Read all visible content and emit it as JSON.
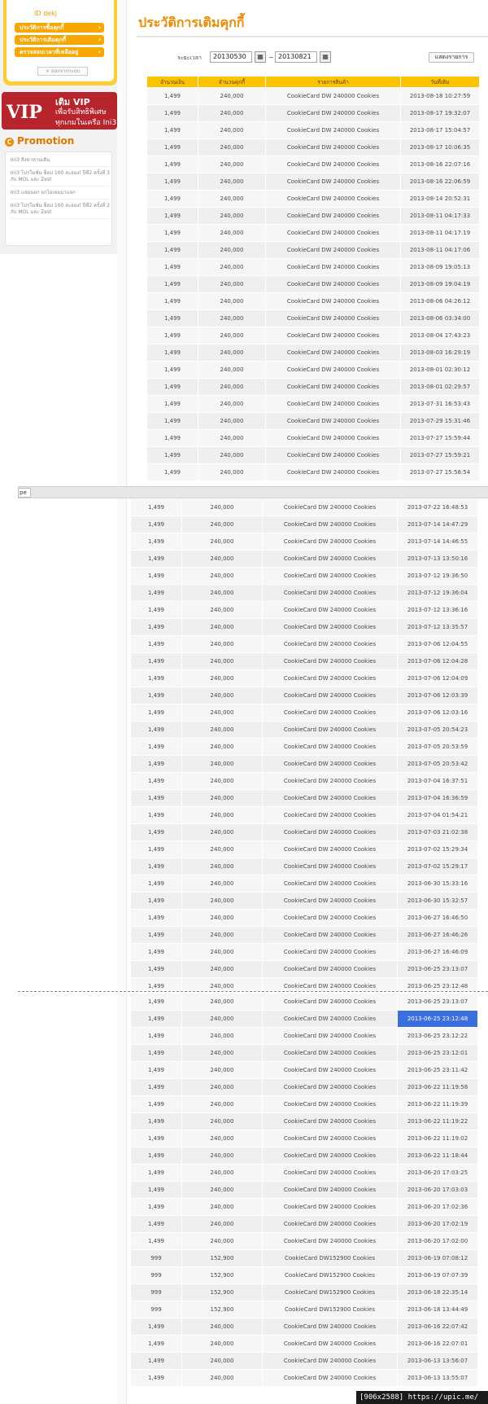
{
  "sidebar": {
    "id_label": "ID dekj",
    "menu": [
      "ประวัติการซื้อคุกกี้",
      "ประวัติการเติมคุกกี้",
      "ตรวจสอบเวลาที่เหลืออยู่"
    ],
    "logout_label": "ออกจากระบบ",
    "vip": {
      "big": "VIP",
      "line1": "เติม VIP",
      "line2": "เพื่อรับสิทธิพิเศษ",
      "line3": "ทุกเกมในเครือ Ini3"
    },
    "promotion_title": "Promotion",
    "promotions": [
      "Ini3 สิ่งหาหานเดิน",
      "Ini3 โปรโมชั่น ช็อป 100 ละออง! ปีที่2 ครั้งที่ 3 กับ MOL และ Zest",
      "Ini3 แจ่มนอก ยกไอเทมมาแจก",
      "Ini3 โปรโมชั่น ช็อป 100 ละออง! ปีที่2 ครั้งที่ 2 กับ MOL และ Zest"
    ]
  },
  "header": {
    "title": "ประวัติการเติมคุกกี้"
  },
  "filter": {
    "label": "ระยะเวลา",
    "from": "20130530",
    "to": "20130821",
    "separator": "~",
    "button": "แสดงรายการ"
  },
  "table": {
    "columns": [
      "จำนวนเงิน",
      "จำนวนคุกกี้",
      "รายการสินค้า",
      "วันที่เติม"
    ],
    "section1": [
      [
        "1,499",
        "240,000",
        "CookieCard DW 240000 Cookies",
        "2013-08-18 10:27:59"
      ],
      [
        "1,499",
        "240,000",
        "CookieCard DW 240000 Cookies",
        "2013-08-17 19:32:07"
      ],
      [
        "1,499",
        "240,000",
        "CookieCard DW 240000 Cookies",
        "2013-08-17 15:04:57"
      ],
      [
        "1,499",
        "240,000",
        "CookieCard DW 240000 Cookies",
        "2013-08-17 10:06:35"
      ],
      [
        "1,499",
        "240,000",
        "CookieCard DW 240000 Cookies",
        "2013-08-16 22:07:16"
      ],
      [
        "1,499",
        "240,000",
        "CookieCard DW 240000 Cookies",
        "2013-08-16 22:06:59"
      ],
      [
        "1,499",
        "240,000",
        "CookieCard DW 240000 Cookies",
        "2013-08-14 20:52:31"
      ],
      [
        "1,499",
        "240,000",
        "CookieCard DW 240000 Cookies",
        "2013-08-11 04:17:33"
      ],
      [
        "1,499",
        "240,000",
        "CookieCard DW 240000 Cookies",
        "2013-08-11 04:17:19"
      ],
      [
        "1,499",
        "240,000",
        "CookieCard DW 240000 Cookies",
        "2013-08-11 04:17:06"
      ],
      [
        "1,499",
        "240,000",
        "CookieCard DW 240000 Cookies",
        "2013-08-09 19:05:13"
      ],
      [
        "1,499",
        "240,000",
        "CookieCard DW 240000 Cookies",
        "2013-08-09 19:04:19"
      ],
      [
        "1,499",
        "240,000",
        "CookieCard DW 240000 Cookies",
        "2013-08-06 04:26:12"
      ],
      [
        "1,499",
        "240,000",
        "CookieCard DW 240000 Cookies",
        "2013-08-06 03:34:00"
      ],
      [
        "1,499",
        "240,000",
        "CookieCard DW 240000 Cookies",
        "2013-08-04 17:43:23"
      ],
      [
        "1,499",
        "240,000",
        "CookieCard DW 240000 Cookies",
        "2013-08-03 16:29:19"
      ],
      [
        "1,499",
        "240,000",
        "CookieCard DW 240000 Cookies",
        "2013-08-01 02:30:12"
      ],
      [
        "1,499",
        "240,000",
        "CookieCard DW 240000 Cookies",
        "2013-08-01 02:29:57"
      ],
      [
        "1,499",
        "240,000",
        "CookieCard DW 240000 Cookies",
        "2013-07-31 16:53:43"
      ],
      [
        "1,499",
        "240,000",
        "CookieCard DW 240000 Cookies",
        "2013-07-29 15:31:46"
      ],
      [
        "1,499",
        "240,000",
        "CookieCard DW 240000 Cookies",
        "2013-07-27 15:59:44"
      ],
      [
        "1,499",
        "240,000",
        "CookieCard DW 240000 Cookies",
        "2013-07-27 15:59:21"
      ],
      [
        "1,499",
        "240,000",
        "CookieCard DW 240000 Cookies",
        "2013-07-27 15:58:54"
      ]
    ],
    "toolbar_fragment": "pe",
    "section2": [
      [
        "1,499",
        "240,000",
        "CookieCard DW 240000 Cookies",
        "2013-07-22 16:48:53"
      ],
      [
        "1,499",
        "240,000",
        "CookieCard DW 240000 Cookies",
        "2013-07-14 14:47:29"
      ],
      [
        "1,499",
        "240,000",
        "CookieCard DW 240000 Cookies",
        "2013-07-14 14:46:55"
      ],
      [
        "1,499",
        "240,000",
        "CookieCard DW 240000 Cookies",
        "2013-07-13 13:50:16"
      ],
      [
        "1,499",
        "240,000",
        "CookieCard DW 240000 Cookies",
        "2013-07-12 19:36:50"
      ],
      [
        "1,499",
        "240,000",
        "CookieCard DW 240000 Cookies",
        "2013-07-12 19:36:04"
      ],
      [
        "1,499",
        "240,000",
        "CookieCard DW 240000 Cookies",
        "2013-07-12 13:36:16"
      ],
      [
        "1,499",
        "240,000",
        "CookieCard DW 240000 Cookies",
        "2013-07-12 13:35:57"
      ],
      [
        "1,499",
        "240,000",
        "CookieCard DW 240000 Cookies",
        "2013-07-06 12:04:55"
      ],
      [
        "1,499",
        "240,000",
        "CookieCard DW 240000 Cookies",
        "2013-07-06 12:04:28"
      ],
      [
        "1,499",
        "240,000",
        "CookieCard DW 240000 Cookies",
        "2013-07-06 12:04:09"
      ],
      [
        "1,499",
        "240,000",
        "CookieCard DW 240000 Cookies",
        "2013-07-06 12:03:39"
      ],
      [
        "1,499",
        "240,000",
        "CookieCard DW 240000 Cookies",
        "2013-07-06 12:03:16"
      ],
      [
        "1,499",
        "240,000",
        "CookieCard DW 240000 Cookies",
        "2013-07-05 20:54:23"
      ],
      [
        "1,499",
        "240,000",
        "CookieCard DW 240000 Cookies",
        "2013-07-05 20:53:59"
      ],
      [
        "1,499",
        "240,000",
        "CookieCard DW 240000 Cookies",
        "2013-07-05 20:53:42"
      ],
      [
        "1,499",
        "240,000",
        "CookieCard DW 240000 Cookies",
        "2013-07-04 16:37:51"
      ],
      [
        "1,499",
        "240,000",
        "CookieCard DW 240000 Cookies",
        "2013-07-04 16:36:59"
      ],
      [
        "1,499",
        "240,000",
        "CookieCard DW 240000 Cookies",
        "2013-07-04 01:54:21"
      ],
      [
        "1,499",
        "240,000",
        "CookieCard DW 240000 Cookies",
        "2013-07-03 21:02:38"
      ],
      [
        "1,499",
        "240,000",
        "CookieCard DW 240000 Cookies",
        "2013-07-02 15:29:34"
      ],
      [
        "1,499",
        "240,000",
        "CookieCard DW 240000 Cookies",
        "2013-07-02 15:29:17"
      ],
      [
        "1,499",
        "240,000",
        "CookieCard DW 240000 Cookies",
        "2013-06-30 15:33:16"
      ],
      [
        "1,499",
        "240,000",
        "CookieCard DW 240000 Cookies",
        "2013-06-30 15:32:57"
      ],
      [
        "1,499",
        "240,000",
        "CookieCard DW 240000 Cookies",
        "2013-06-27 16:46:50"
      ],
      [
        "1,499",
        "240,000",
        "CookieCard DW 240000 Cookies",
        "2013-06-27 16:46:26"
      ],
      [
        "1,499",
        "240,000",
        "CookieCard DW 240000 Cookies",
        "2013-06-27 16:46:09"
      ],
      [
        "1,499",
        "240,000",
        "CookieCard DW 240000 Cookies",
        "2013-06-25 23:13:07"
      ],
      [
        "1,499",
        "240,000",
        "CookieCard DW 240000 Cookies",
        "2013-06-25 23:12:48"
      ]
    ],
    "section3": [
      [
        "1,499",
        "240,000",
        "CookieCard DW 240000 Cookies",
        "2013-06-25 23:13:07"
      ],
      [
        "1,499",
        "240,000",
        "CookieCard DW 240000 Cookies",
        "2013-06-25 23:12:48"
      ],
      [
        "1,499",
        "240,000",
        "CookieCard DW 240000 Cookies",
        "2013-06-25 23:12:22"
      ],
      [
        "1,499",
        "240,000",
        "CookieCard DW 240000 Cookies",
        "2013-06-25 23:12:01"
      ],
      [
        "1,499",
        "240,000",
        "CookieCard DW 240000 Cookies",
        "2013-06-25 23:11:42"
      ],
      [
        "1,499",
        "240,000",
        "CookieCard DW 240000 Cookies",
        "2013-06-22 11:19:58"
      ],
      [
        "1,499",
        "240,000",
        "CookieCard DW 240000 Cookies",
        "2013-06-22 11:19:39"
      ],
      [
        "1,499",
        "240,000",
        "CookieCard DW 240000 Cookies",
        "2013-06-22 11:19:22"
      ],
      [
        "1,499",
        "240,000",
        "CookieCard DW 240000 Cookies",
        "2013-06-22 11:19:02"
      ],
      [
        "1,499",
        "240,000",
        "CookieCard DW 240000 Cookies",
        "2013-06-22 11:18:44"
      ],
      [
        "1,499",
        "240,000",
        "CookieCard DW 240000 Cookies",
        "2013-06-20 17:03:25"
      ],
      [
        "1,499",
        "240,000",
        "CookieCard DW 240000 Cookies",
        "2013-06-20 17:03:03"
      ],
      [
        "1,499",
        "240,000",
        "CookieCard DW 240000 Cookies",
        "2013-06-20 17:02:36"
      ],
      [
        "1,499",
        "240,000",
        "CookieCard DW 240000 Cookies",
        "2013-06-20 17:02:19"
      ],
      [
        "1,499",
        "240,000",
        "CookieCard DW 240000 Cookies",
        "2013-06-20 17:02:00"
      ],
      [
        "999",
        "152,900",
        "CookieCard DW152900 Cookies",
        "2013-06-19 07:08:12"
      ],
      [
        "999",
        "152,900",
        "CookieCard DW152900 Cookies",
        "2013-06-19 07:07:39"
      ],
      [
        "999",
        "152,900",
        "CookieCard DW152900 Cookies",
        "2013-06-18 22:35:14"
      ],
      [
        "999",
        "152,900",
        "CookieCard DW152900 Cookies",
        "2013-06-18 13:44:49"
      ],
      [
        "1,499",
        "240,000",
        "CookieCard DW 240000 Cookies",
        "2013-06-16 22:07:42"
      ],
      [
        "1,499",
        "240,000",
        "CookieCard DW 240000 Cookies",
        "2013-06-16 22:07:01"
      ],
      [
        "1,499",
        "240,000",
        "CookieCard DW 240000 Cookies",
        "2013-06-13 13:56:07"
      ],
      [
        "1,499",
        "240,000",
        "CookieCard DW 240000 Cookies",
        "2013-06-13 13:55:07"
      ]
    ],
    "highlighted": {
      "section": "section3",
      "row": 1
    }
  },
  "watermark": "[906x2588] https://upic.me/",
  "colors": {
    "accent": "#f08a00",
    "header_bg": "#fbc300",
    "vip_bg": "#b8242b",
    "highlight": "#3b6fe0"
  }
}
